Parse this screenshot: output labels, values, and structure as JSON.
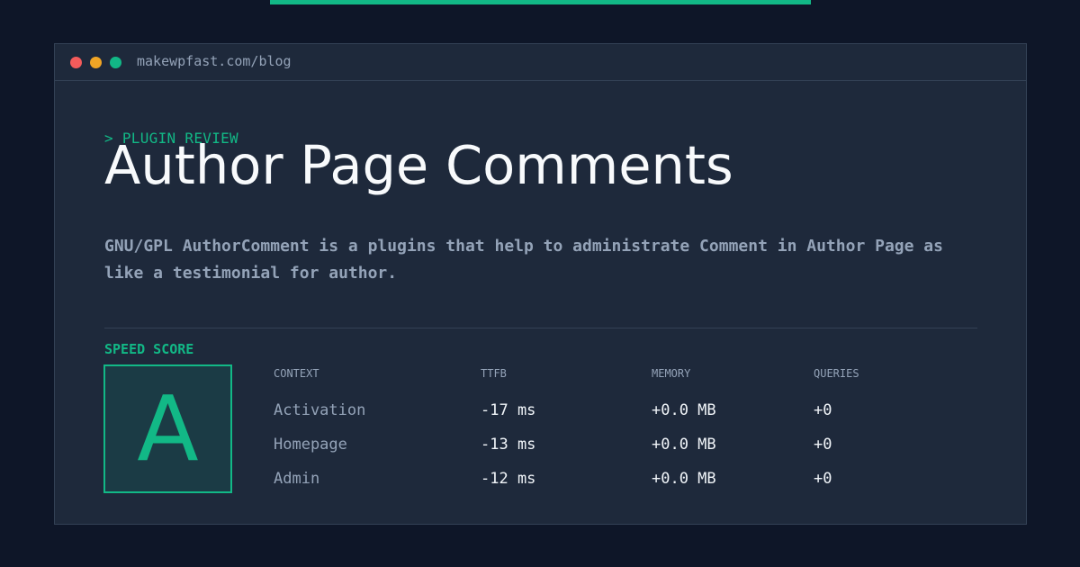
{
  "colors": {
    "background": "#0e1628",
    "panel": "#1e293b",
    "accent": "#12b886",
    "dot_red": "#f45b5b",
    "dot_yellow": "#f0a525",
    "dot_green": "#12b886"
  },
  "window": {
    "url": "makewpfast.com/blog"
  },
  "article": {
    "eyebrow": "> PLUGIN REVIEW",
    "title": "Author Page Comments",
    "description": "GNU/GPL AuthorComment is a plugins that help to administrate Comment in Author Page as like a testimonial for author."
  },
  "speed": {
    "label": "SPEED SCORE",
    "grade": "A"
  },
  "table": {
    "headers": [
      "CONTEXT",
      "TTFB",
      "MEMORY",
      "QUERIES"
    ],
    "rows": [
      [
        "Activation",
        "-17 ms",
        "+0.0 MB",
        "+0"
      ],
      [
        "Homepage",
        "-13 ms",
        "+0.0 MB",
        "+0"
      ],
      [
        "Admin",
        "-12 ms",
        "+0.0 MB",
        "+0"
      ]
    ]
  }
}
